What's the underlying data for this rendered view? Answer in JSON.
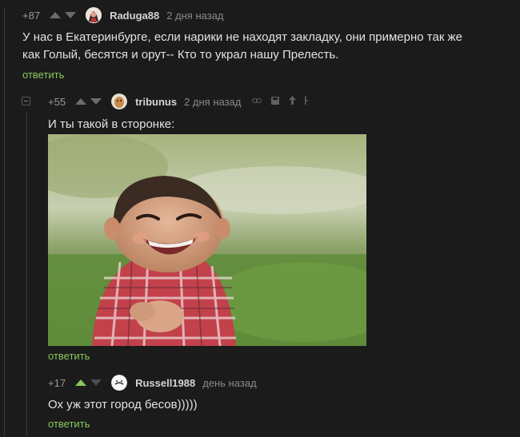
{
  "comments": [
    {
      "rating": "+87",
      "username": "Raduga88",
      "time": "2 дня назад",
      "text": "У нас в Екатеринбурге, если нарики не находят закладку, они примерно так же как Голый, бесятся и орут-- Кто то украл нашу Прелесть.",
      "reply_label": "ответить"
    },
    {
      "rating": "+55",
      "username": "tribunus",
      "time": "2 дня назад",
      "text": "И ты такой в сторонке:",
      "reply_label": "ответить"
    },
    {
      "rating": "+17",
      "username": "Russell1988",
      "time": "день назад",
      "text": "Ох уж этот город бесов)))))",
      "reply_label": "ответить"
    }
  ],
  "colors": {
    "background": "#1b1b1c",
    "accent_green": "#8ac858",
    "text": "#e2e2e4",
    "muted": "#8a8a8c"
  },
  "icons": [
    "arrow-up-icon",
    "arrow-down-icon",
    "link-icon",
    "save-icon",
    "up-icon",
    "more-icon",
    "collapse-icon"
  ]
}
